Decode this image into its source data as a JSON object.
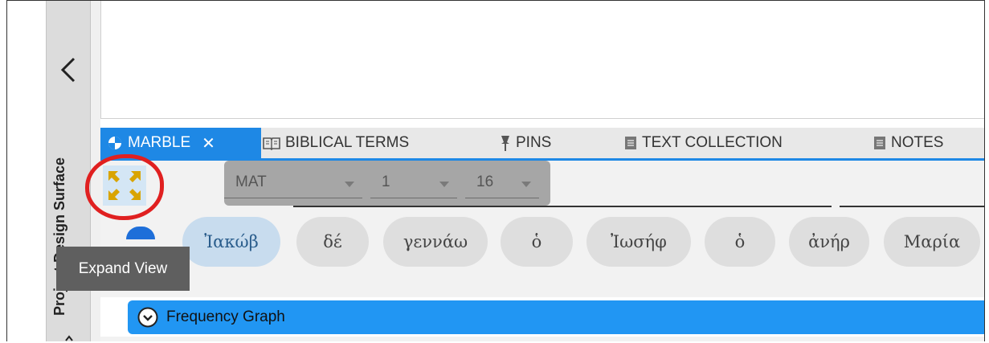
{
  "side_panel": {
    "label": "Project Design Surface"
  },
  "tabs": [
    {
      "label": "MARBLE",
      "icon": "marble-icon",
      "close": "✕",
      "active": true
    },
    {
      "label": "BIBLICAL TERMS",
      "icon": "book-icon",
      "active": false
    },
    {
      "label": "PINS",
      "icon": "pin-icon",
      "active": false
    },
    {
      "label": "TEXT COLLECTION",
      "icon": "document-icon",
      "active": false
    },
    {
      "label": "NOTES",
      "icon": "document-icon",
      "active": false
    }
  ],
  "reference": {
    "book": "MAT",
    "chapter": "1",
    "verse": "16"
  },
  "words": [
    "Ἰακώβ",
    "δέ",
    "γεννάω",
    "ὁ",
    "Ἰωσήφ",
    "ὁ",
    "ἀνήρ",
    "Μαρία"
  ],
  "selected_word_index": 0,
  "tooltip": "Expand View",
  "frequency_graph": {
    "title": "Frequency Graph"
  },
  "colors": {
    "accent": "#1e88e5",
    "highlight": "#e02020",
    "expand_icon": "#d9a400"
  }
}
